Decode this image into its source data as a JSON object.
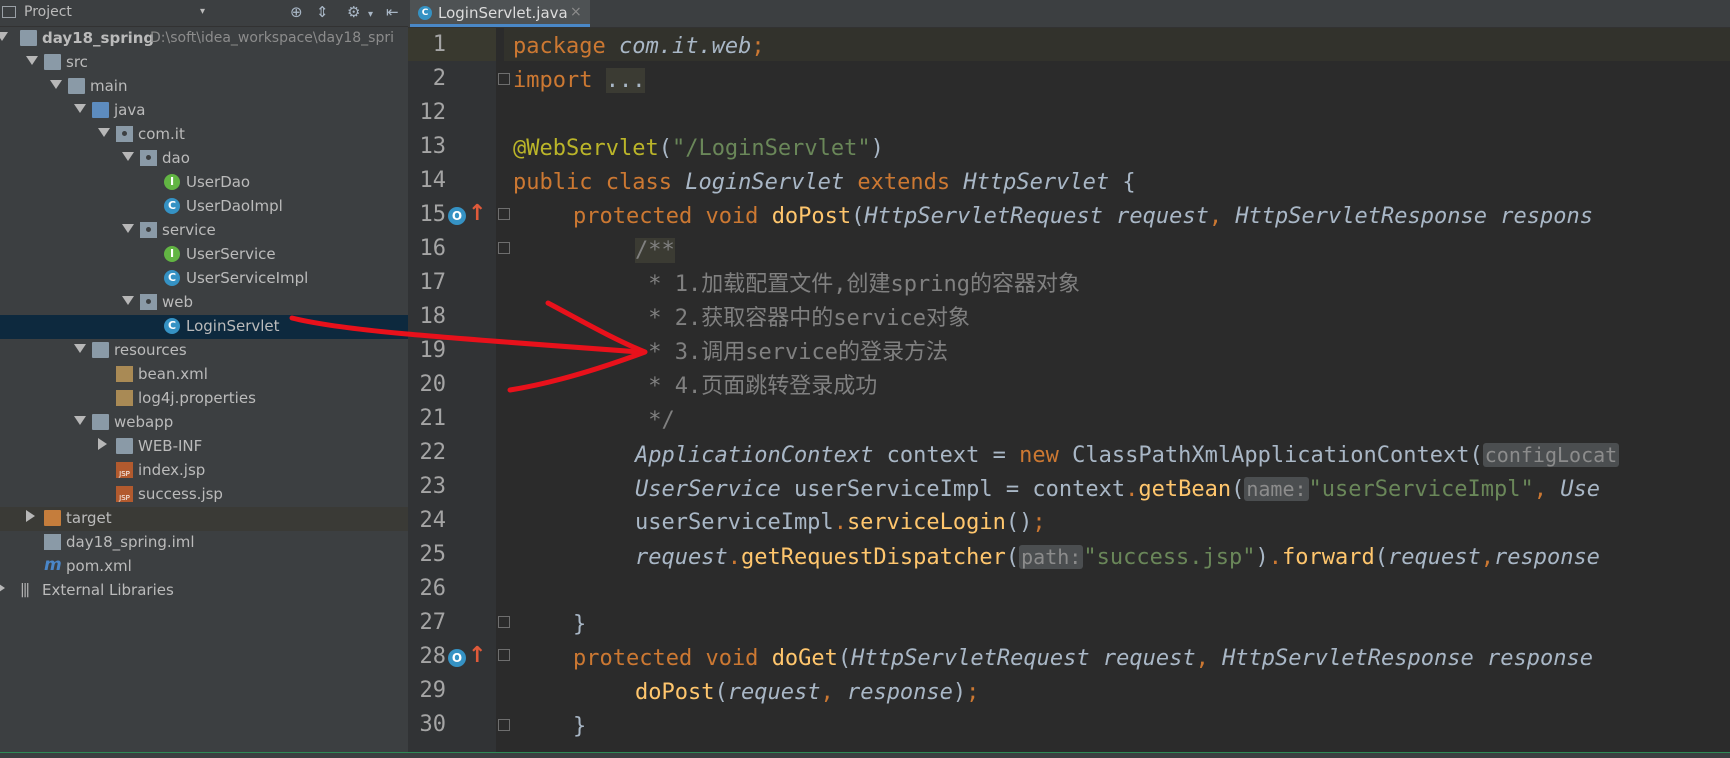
{
  "project_panel": {
    "title": "Project",
    "dropdown": "▾",
    "tree": [
      {
        "label": "day18_spring",
        "path": "D:\\soft\\idea_workspace\\day18_spri",
        "icon": "project-folder-icon",
        "depth": 0,
        "expanded": true
      },
      {
        "label": "src",
        "icon": "folder-icon",
        "depth": 1,
        "expanded": true
      },
      {
        "label": "main",
        "icon": "folder-icon",
        "depth": 2,
        "expanded": true
      },
      {
        "label": "java",
        "icon": "source-folder-icon",
        "depth": 3,
        "expanded": true
      },
      {
        "label": "com.it",
        "icon": "package-icon",
        "depth": 4,
        "expanded": true
      },
      {
        "label": "dao",
        "icon": "package-icon",
        "depth": 5,
        "expanded": true
      },
      {
        "label": "UserDao",
        "icon": "interface-icon",
        "depth": 6
      },
      {
        "label": "UserDaoImpl",
        "icon": "class-icon",
        "depth": 6
      },
      {
        "label": "service",
        "icon": "package-icon",
        "depth": 5,
        "expanded": true
      },
      {
        "label": "UserService",
        "icon": "interface-icon",
        "depth": 6
      },
      {
        "label": "UserServiceImpl",
        "icon": "class-icon",
        "depth": 6
      },
      {
        "label": "web",
        "icon": "package-icon",
        "depth": 5,
        "expanded": true
      },
      {
        "label": "LoginServlet",
        "icon": "class-icon",
        "depth": 6,
        "selected": true
      },
      {
        "label": "resources",
        "icon": "resources-folder-icon",
        "depth": 3,
        "expanded": true
      },
      {
        "label": "bean.xml",
        "icon": "xml-file-icon",
        "depth": 4
      },
      {
        "label": "log4j.properties",
        "icon": "properties-file-icon",
        "depth": 4
      },
      {
        "label": "webapp",
        "icon": "folder-icon",
        "depth": 3,
        "expanded": true
      },
      {
        "label": "WEB-INF",
        "icon": "folder-icon",
        "depth": 4,
        "expanded": false
      },
      {
        "label": "index.jsp",
        "icon": "jsp-file-icon",
        "depth": 4
      },
      {
        "label": "success.jsp",
        "icon": "jsp-file-icon",
        "depth": 4
      },
      {
        "label": "target",
        "icon": "excluded-folder-icon",
        "depth": 1,
        "expanded": false
      },
      {
        "label": "day18_spring.iml",
        "icon": "iml-file-icon",
        "depth": 1
      },
      {
        "label": "pom.xml",
        "icon": "maven-icon",
        "depth": 1
      },
      {
        "label": "External Libraries",
        "icon": "libraries-icon",
        "depth": 0,
        "expanded": false
      }
    ]
  },
  "editor": {
    "tab": {
      "label": "LoginServlet.java",
      "close": "×"
    },
    "lines": [
      {
        "n": "1"
      },
      {
        "n": "2"
      },
      {
        "n": "12"
      },
      {
        "n": "13"
      },
      {
        "n": "14"
      },
      {
        "n": "15"
      },
      {
        "n": "16"
      },
      {
        "n": "17"
      },
      {
        "n": "18"
      },
      {
        "n": "19"
      },
      {
        "n": "20"
      },
      {
        "n": "21"
      },
      {
        "n": "22"
      },
      {
        "n": "23"
      },
      {
        "n": "24"
      },
      {
        "n": "25"
      },
      {
        "n": "26"
      },
      {
        "n": "27"
      },
      {
        "n": "28"
      },
      {
        "n": "29"
      },
      {
        "n": "30"
      }
    ],
    "code": {
      "l1_kw": "package",
      "l1_pkg": "com.it.web",
      "l1_semi": ";",
      "l2_kw": "import",
      "l2_dots": "...",
      "l13_ann": "@WebServlet",
      "l13_open": "(",
      "l13_str": "\"/LoginServlet\"",
      "l13_close": ")",
      "l14_kw": "public class",
      "l14_cls": "LoginServlet",
      "l14_ext": "extends",
      "l14_sup": "HttpServlet",
      "l14_brace": "{",
      "l15_kw": "protected void",
      "l15_m": "doPost",
      "l15_p1t": "HttpServletRequest",
      "l15_p1": "request",
      "l15_comma": ",",
      "l15_p2t": "HttpServletResponse",
      "l15_p2": "respons",
      "l16": "/**",
      "l17": " * 1.加载配置文件,创建spring的容器对象",
      "l18": " * 2.获取容器中的service对象",
      "l19": " * 3.调用service的登录方法",
      "l20": " * 4.页面跳转登录成功",
      "l21": " */",
      "l22_t": "ApplicationContext",
      "l22_v": "context",
      "l22_eq": "=",
      "l22_new": "new",
      "l22_c": "ClassPathXmlApplicationContext",
      "l22_open": "(",
      "l22_hint": "configLocat",
      "l23_t": "UserService",
      "l23_v": "userServiceImpl",
      "l23_eq": "=",
      "l23_obj": "context",
      "l23_dot": ".",
      "l23_m": "getBean",
      "l23_open": "(",
      "l23_hint": "name:",
      "l23_str": "\"userServiceImpl\"",
      "l23_comma": ",",
      "l23_tail": "Use",
      "l24_v": "userServiceImpl",
      "l24_dot": ".",
      "l24_m": "serviceLogin",
      "l24_par": "()",
      "l24_semi": ";",
      "l25_v": "request",
      "l25_dot": ".",
      "l25_m": "getRequestDispatcher",
      "l25_open": "(",
      "l25_hint": "path:",
      "l25_str": "\"success.jsp\"",
      "l25_close": ")",
      "l25_dot2": ".",
      "l25_m2": "forward",
      "l25_open2": "(",
      "l25_a1": "request",
      "l25_comma": ",",
      "l25_a2": "response",
      "l27": "}",
      "l28_kw": "protected void",
      "l28_m": "doGet",
      "l28_p1t": "HttpServletRequest",
      "l28_p1": "request",
      "l28_comma": ",",
      "l28_p2t": "HttpServletResponse",
      "l28_p2": "response",
      "l29_m": "doPost",
      "l29_open": "(",
      "l29_a1": "request",
      "l29_comma": ",",
      "l29_a2": "response",
      "l29_close": ")",
      "l29_semi": ";",
      "l30": "}"
    }
  },
  "annotation": {
    "color": "#e8111b"
  }
}
